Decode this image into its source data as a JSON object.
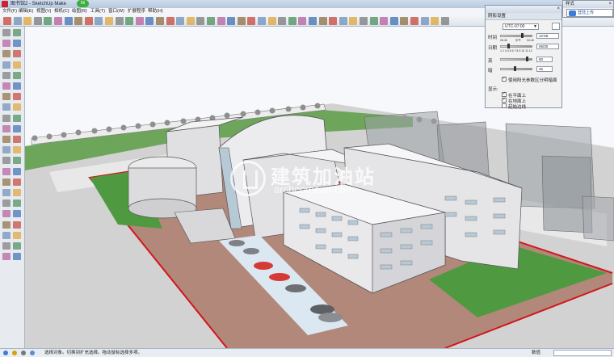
{
  "window": {
    "title": "图书馆2 - SketchUp Make",
    "notification_count": "56"
  },
  "menu": {
    "items": [
      "文件(F)",
      "编辑(E)",
      "视图(V)",
      "相机(C)",
      "绘图(R)",
      "工具(T)",
      "窗口(W)",
      "扩展程序",
      "帮助(H)"
    ]
  },
  "toolbar": {
    "icons": [
      "cursor-icon",
      "eraser-icon",
      "pencil-icon",
      "rectangle-icon",
      "circle-icon",
      "arc-icon",
      "push-pull-icon",
      "move-icon",
      "rotate-icon",
      "scale-icon",
      "offset-icon",
      "tape-measure-icon",
      "dimension-icon",
      "protractor-icon",
      "text-icon",
      "axes-icon",
      "3d-text-icon",
      "paint-bucket-icon",
      "orbit-icon",
      "pan-icon",
      "zoom-icon",
      "zoom-window-icon",
      "zoom-extents-icon",
      "previous-view-icon",
      "iso-view-icon",
      "top-view-icon",
      "front-view-icon",
      "right-view-icon",
      "back-view-icon",
      "left-view-icon",
      "xray-icon",
      "wireframe-icon",
      "hidden-line-icon",
      "shaded-icon",
      "shaded-texture-icon",
      "monochrome-icon",
      "warehouse-icon",
      "share-model-icon",
      "extension-icon",
      "layout-icon",
      "component-icon",
      "section-plane-icon",
      "section-display-icon",
      "section-cut-icon",
      "walk-icon",
      "look-around-icon",
      "position-camera-icon",
      "sandbox-icon"
    ]
  },
  "style_panel": {
    "title": "样式",
    "upload_label": "登陆上传"
  },
  "shadow_panel": {
    "title": "阴影设置",
    "timezone": "UTC-07:00",
    "time_label": "时间",
    "time_value": "12:59",
    "time_scale_left": "06:45",
    "time_scale_mid": "中午",
    "time_scale_right": "04:46",
    "date_label": "日期",
    "date_value": "06/30",
    "date_scale": "1 2 3 4 5 6 7 8 9 10 11 12",
    "light_label": "亮",
    "light_value": "80",
    "dark_label": "暗",
    "dark_value": "45",
    "sun_shading_label": "使用阳光参数区分明暗面",
    "display_label": "显示:",
    "on_faces_label": "在平面上",
    "on_ground_label": "在地面上",
    "from_edges_label": "起始边线"
  },
  "status": {
    "hint": "选择对象。切换到扩充选择。拖动鼠标选择多项。",
    "measure_label": "数值"
  },
  "watermark": {
    "cn": "建筑加油站",
    "en": "archcomeon.com"
  },
  "colors": {
    "sky": "#f6f8fb",
    "ground": "#d4d4d4",
    "lawn": "#4f9a41",
    "plaza": "#b2887a",
    "boundary": "#d2161c",
    "building": "#e9e9ec",
    "glass": "#b8c9d6"
  }
}
